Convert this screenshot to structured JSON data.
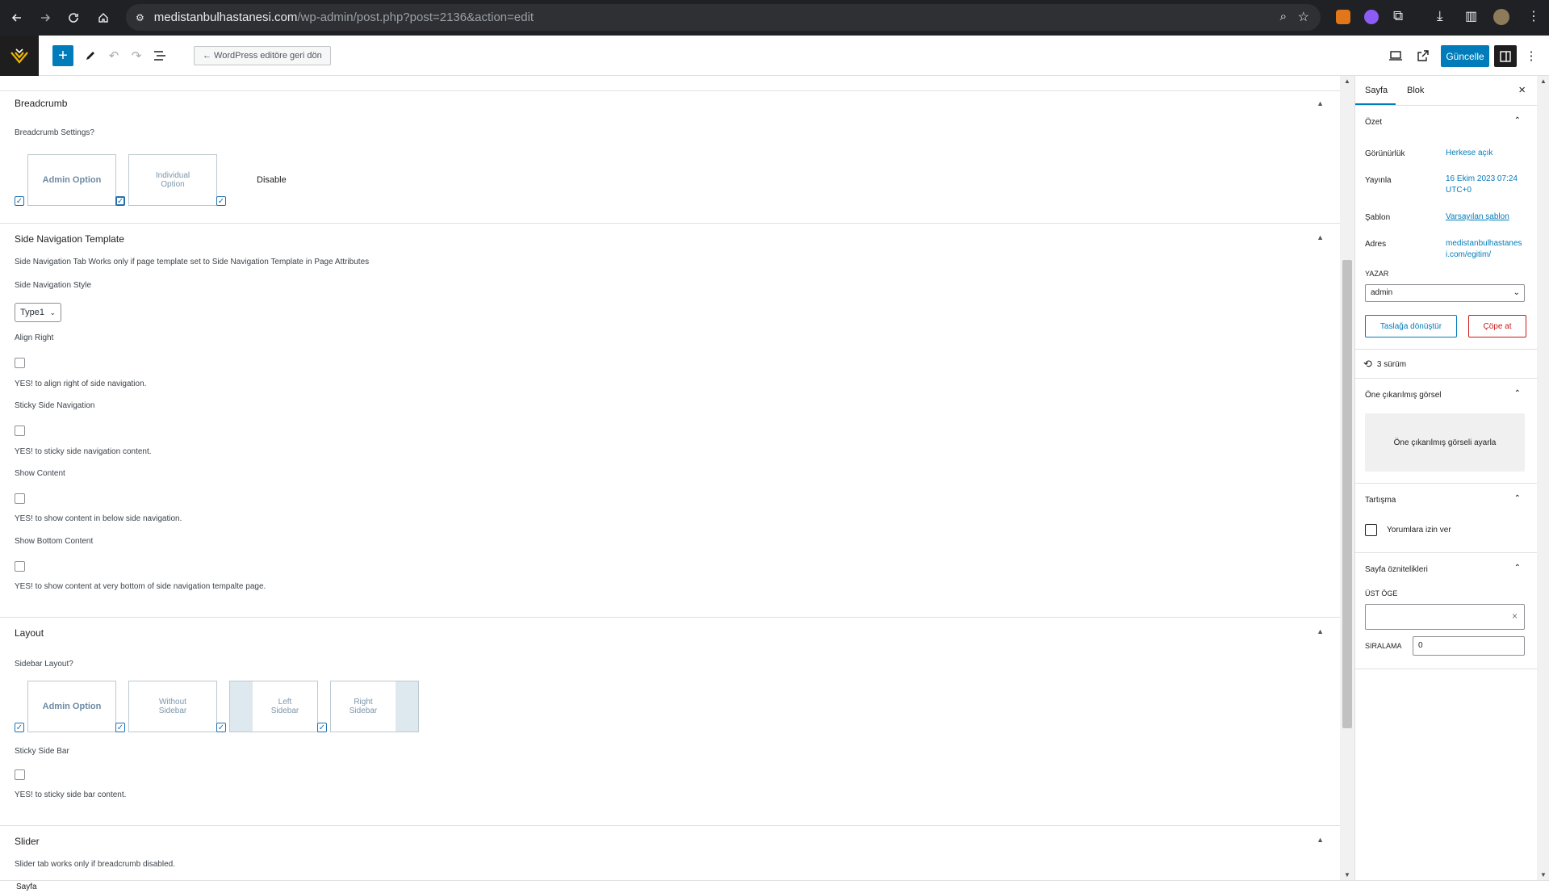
{
  "browser": {
    "url_host": "medistanbulhastanesi.com",
    "url_path": "/wp-admin/post.php?post=2136&action=edit"
  },
  "toolbar": {
    "back_label": "← WordPress editöre geri dön",
    "update_label": "Güncelle"
  },
  "breadcrumb_section": {
    "title": "Breadcrumb",
    "settings_label": "Breadcrumb Settings?",
    "options": [
      "Admin Option",
      "Individual Option",
      "Disable"
    ]
  },
  "side_nav_section": {
    "title": "Side Navigation Template",
    "note": "Side Navigation Tab Works only if page template set to Side Navigation Template in Page Attributes",
    "style_label": "Side Navigation Style",
    "style_value": "Type1",
    "align_right_label": "Align Right",
    "align_right_desc": "YES! to align right of side navigation.",
    "sticky_label": "Sticky Side Navigation",
    "sticky_desc": "YES! to sticky side navigation content.",
    "show_content_label": "Show Content",
    "show_content_desc": "YES! to show content in below side navigation.",
    "show_bottom_label": "Show Bottom Content",
    "show_bottom_desc": "YES! to show content at very bottom of side navigation tempalte page."
  },
  "layout_section": {
    "title": "Layout",
    "sidebar_label": "Sidebar Layout?",
    "options": [
      "Admin Option",
      "Without Sidebar",
      "Left Sidebar",
      "Right Sidebar"
    ],
    "sticky_label": "Sticky Side Bar",
    "sticky_desc": "YES! to sticky side bar content."
  },
  "slider_section": {
    "title": "Slider",
    "note": "Slider tab works only if breadcrumb disabled."
  },
  "panel": {
    "tab_page": "Sayfa",
    "tab_block": "Blok",
    "summary_title": "Özet",
    "visibility_label": "Görünürlük",
    "visibility_value": "Herkese açık",
    "publish_label": "Yayınla",
    "publish_value": "16 Ekim 2023 07:24 UTC+0",
    "template_label": "Şablon",
    "template_value": "Varsayılan şablon",
    "address_label": "Adres",
    "address_value": "medistanbulhastanesi.com/egitim/",
    "author_label": "YAZAR",
    "author_value": "admin",
    "draft_button": "Taslağa dönüştür",
    "trash_button": "Çöpe at",
    "revisions": "3 sürüm",
    "featured_title": "Öne çıkarılmış görsel",
    "featured_button": "Öne çıkarılmış görseli ayarla",
    "discussion_title": "Tartışma",
    "comments_label": "Yorumlara izin ver",
    "attributes_title": "Sayfa öznitelikleri",
    "parent_label": "ÜST ÖGE",
    "order_label": "SIRALAMA",
    "order_value": "0"
  },
  "status": {
    "text": "Sayfa"
  }
}
